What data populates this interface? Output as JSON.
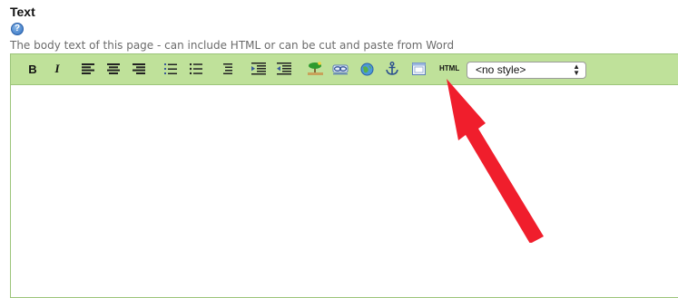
{
  "field": {
    "title": "Text",
    "help_glyph": "?",
    "description": "The body text of this page - can include HTML or can be cut and paste from Word"
  },
  "toolbar": {
    "bold_label": "B",
    "italic_label": "I",
    "html_label": "HTML",
    "style_select_value": "<no style>",
    "icons": [
      "bold-icon",
      "italic-icon",
      "align-left-icon",
      "align-center-icon",
      "align-right-icon",
      "ordered-list-icon",
      "unordered-list-icon",
      "outdent-icon",
      "indent-icon",
      "indent-more-icon",
      "insert-image-icon",
      "insert-link-icon",
      "web-link-icon",
      "anchor-icon",
      "insert-table-icon"
    ]
  },
  "colors": {
    "toolbar_background": "#bfe19a",
    "editor_border": "#9cc47a",
    "annotation_arrow": "#f01e2c",
    "help_icon": "#2f6fc0"
  }
}
